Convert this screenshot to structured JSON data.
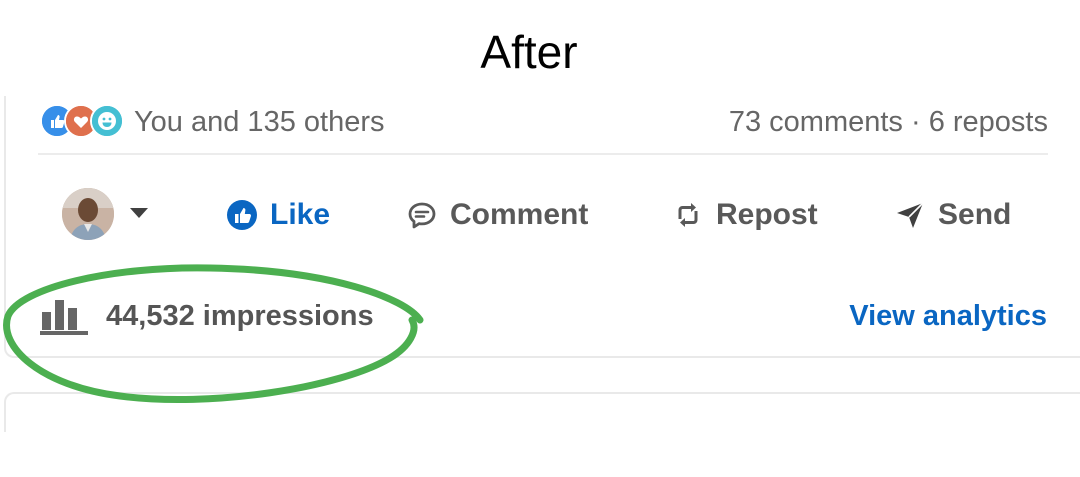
{
  "heading": "After",
  "post": {
    "reactions": [
      "like-reaction-icon",
      "love-reaction-icon",
      "funny-reaction-icon"
    ],
    "social_text": "You and 135 others",
    "counts_text": "73 comments · 6 reposts"
  },
  "actions": {
    "like": "Like",
    "comment": "Comment",
    "repost": "Repost",
    "send": "Send"
  },
  "stats": {
    "impressions": "44,532 impressions",
    "analytics_link": "View analytics"
  },
  "colors": {
    "accent": "#0a66c2",
    "highlight": "#4caf50"
  }
}
